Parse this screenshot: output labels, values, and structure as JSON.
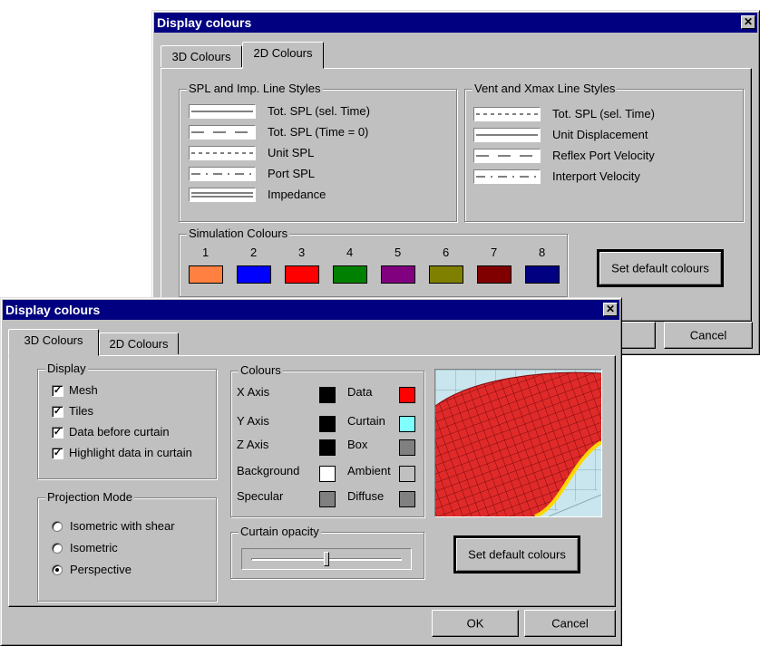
{
  "back_dialog": {
    "title": "Display colours",
    "close": "✕",
    "tabs": [
      "3D Colours",
      "2D Colours"
    ],
    "spl_group": {
      "label": "SPL and Imp. Line Styles",
      "items": [
        "Tot. SPL (sel. Time)",
        "Tot. SPL (Time = 0)",
        "Unit SPL",
        "Port SPL",
        "Impedance"
      ]
    },
    "vent_group": {
      "label": "Vent and Xmax Line Styles",
      "items": [
        "Tot. SPL (sel. Time)",
        "Unit Displacement",
        "Reflex Port Velocity",
        "Interport Velocity"
      ]
    },
    "sim_group": {
      "label": "Simulation Colours",
      "numbers": [
        "1",
        "2",
        "3",
        "4",
        "5",
        "6",
        "7",
        "8"
      ],
      "colors": [
        "#ff8040",
        "#0000ff",
        "#ff0000",
        "#008000",
        "#800080",
        "#808000",
        "#800000",
        "#000080"
      ]
    },
    "set_default": "Set default colours",
    "cancel": "Cancel"
  },
  "front_dialog": {
    "title": "Display colours",
    "close": "✕",
    "tabs": [
      "3D Colours",
      "2D Colours"
    ],
    "display_group": {
      "label": "Display",
      "items": [
        {
          "label": "Mesh",
          "checked": true
        },
        {
          "label": "Tiles",
          "checked": true
        },
        {
          "label": "Data before curtain",
          "checked": true
        },
        {
          "label": "Highlight data in curtain",
          "checked": true
        }
      ]
    },
    "projection_group": {
      "label": "Projection Mode",
      "items": [
        {
          "label": "Isometric with shear",
          "selected": false
        },
        {
          "label": "Isometric",
          "selected": false
        },
        {
          "label": "Perspective",
          "selected": true
        }
      ]
    },
    "colours_group": {
      "label": "Colours",
      "left": [
        {
          "label": "X Axis",
          "color": "#000000"
        },
        {
          "label": "Y Axis",
          "color": "#000000"
        },
        {
          "label": "Z Axis",
          "color": "#000000"
        },
        {
          "label": "Background",
          "color": "#ffffff"
        },
        {
          "label": "Specular",
          "color": "#808080"
        }
      ],
      "right": [
        {
          "label": "Data",
          "color": "#ff0000"
        },
        {
          "label": "Curtain",
          "color": "#80ffff"
        },
        {
          "label": "Box",
          "color": "#808080"
        },
        {
          "label": "Ambient",
          "color": "#c0c0c0"
        },
        {
          "label": "Diffuse",
          "color": "#808080"
        }
      ]
    },
    "opacity_group": {
      "label": "Curtain opacity",
      "value": 0.5
    },
    "set_default": "Set default colours",
    "ok": "OK",
    "cancel": "Cancel"
  }
}
